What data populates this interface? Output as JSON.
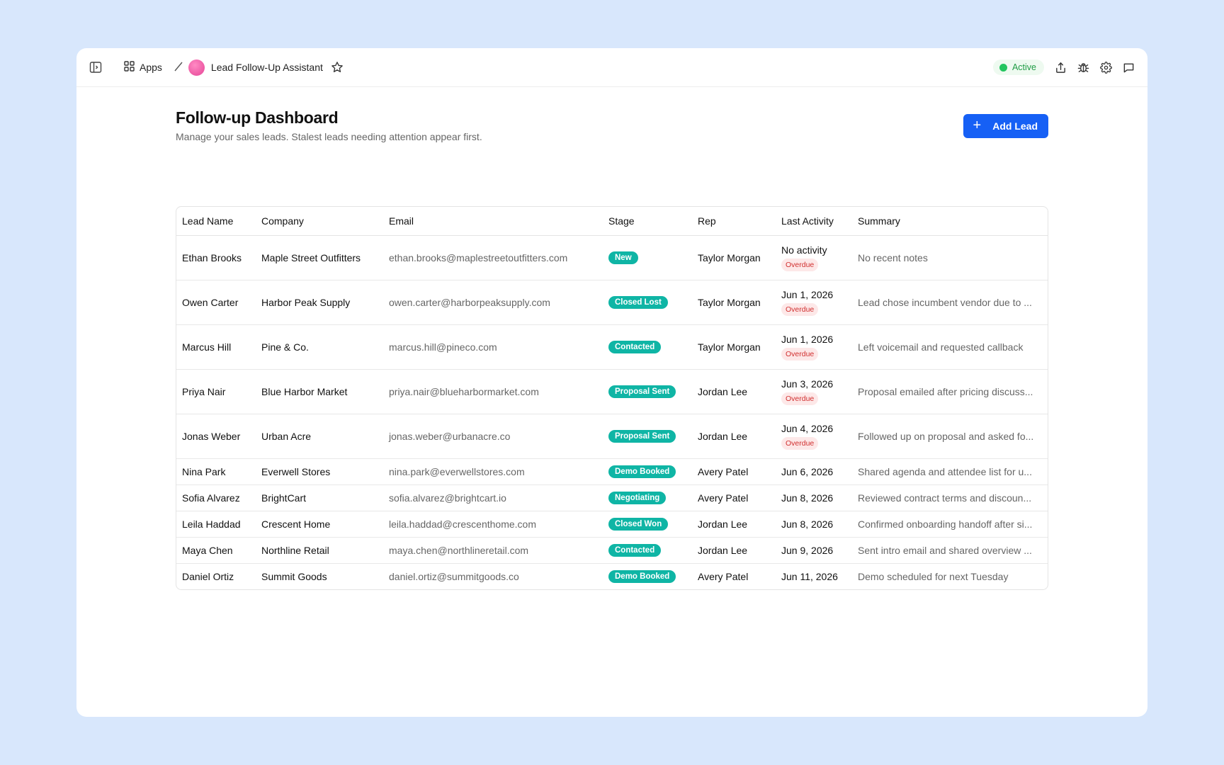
{
  "topbar": {
    "apps_label": "Apps",
    "app_title": "Lead Follow-Up Assistant",
    "status_label": "Active",
    "status_color": "#22c55e"
  },
  "header": {
    "title": "Follow-up Dashboard",
    "subtitle": "Manage your sales leads. Stalest leads needing attention appear first.",
    "add_button_label": "Add Lead"
  },
  "table": {
    "columns": [
      "Lead Name",
      "Company",
      "Email",
      "Stage",
      "Rep",
      "Last Activity",
      "Summary"
    ],
    "rows": [
      {
        "name": "Ethan Brooks",
        "company": "Maple Street Outfitters",
        "email": "ethan.brooks@maplestreetoutfitters.com",
        "stage": "New",
        "rep": "Taylor Morgan",
        "last_activity": "No activity",
        "overdue": "Overdue",
        "summary": "No recent notes"
      },
      {
        "name": "Owen Carter",
        "company": "Harbor Peak Supply",
        "email": "owen.carter@harborpeaksupply.com",
        "stage": "Closed Lost",
        "rep": "Taylor Morgan",
        "last_activity": "Jun 1, 2026",
        "overdue": "Overdue",
        "summary": "Lead chose incumbent vendor due to ..."
      },
      {
        "name": "Marcus Hill",
        "company": "Pine & Co.",
        "email": "marcus.hill@pineco.com",
        "stage": "Contacted",
        "rep": "Taylor Morgan",
        "last_activity": "Jun 1, 2026",
        "overdue": "Overdue",
        "summary": "Left voicemail and requested callback"
      },
      {
        "name": "Priya Nair",
        "company": "Blue Harbor Market",
        "email": "priya.nair@blueharbormarket.com",
        "stage": "Proposal Sent",
        "rep": "Jordan Lee",
        "last_activity": "Jun 3, 2026",
        "overdue": "Overdue",
        "summary": "Proposal emailed after pricing discuss..."
      },
      {
        "name": "Jonas Weber",
        "company": "Urban Acre",
        "email": "jonas.weber@urbanacre.co",
        "stage": "Proposal Sent",
        "rep": "Jordan Lee",
        "last_activity": "Jun 4, 2026",
        "overdue": "Overdue",
        "summary": "Followed up on proposal and asked fo..."
      },
      {
        "name": "Nina Park",
        "company": "Everwell Stores",
        "email": "nina.park@everwellstores.com",
        "stage": "Demo Booked",
        "rep": "Avery Patel",
        "last_activity": "Jun 6, 2026",
        "overdue": null,
        "summary": "Shared agenda and attendee list for u..."
      },
      {
        "name": "Sofia Alvarez",
        "company": "BrightCart",
        "email": "sofia.alvarez@brightcart.io",
        "stage": "Negotiating",
        "rep": "Avery Patel",
        "last_activity": "Jun 8, 2026",
        "overdue": null,
        "summary": "Reviewed contract terms and discoun..."
      },
      {
        "name": "Leila Haddad",
        "company": "Crescent Home",
        "email": "leila.haddad@crescenthome.com",
        "stage": "Closed Won",
        "rep": "Jordan Lee",
        "last_activity": "Jun 8, 2026",
        "overdue": null,
        "summary": "Confirmed onboarding handoff after si..."
      },
      {
        "name": "Maya Chen",
        "company": "Northline Retail",
        "email": "maya.chen@northlineretail.com",
        "stage": "Contacted",
        "rep": "Jordan Lee",
        "last_activity": "Jun 9, 2026",
        "overdue": null,
        "summary": "Sent intro email and shared overview ..."
      },
      {
        "name": "Daniel Ortiz",
        "company": "Summit Goods",
        "email": "daniel.ortiz@summitgoods.co",
        "stage": "Demo Booked",
        "rep": "Avery Patel",
        "last_activity": "Jun 11, 2026",
        "overdue": null,
        "summary": "Demo scheduled for next Tuesday"
      }
    ]
  },
  "colors": {
    "accent": "#1660f5",
    "stage_badge": "#0fb5a5",
    "overdue_bg": "#fde8e8",
    "overdue_text": "#d12f2f"
  },
  "icons": {
    "sidebar_toggle": "sidebar-toggle-icon",
    "apps": "grid-icon",
    "star": "star-icon",
    "share": "share-icon",
    "debug": "bug-icon",
    "settings": "gear-icon",
    "chat": "chat-icon",
    "add": "plus-icon"
  }
}
